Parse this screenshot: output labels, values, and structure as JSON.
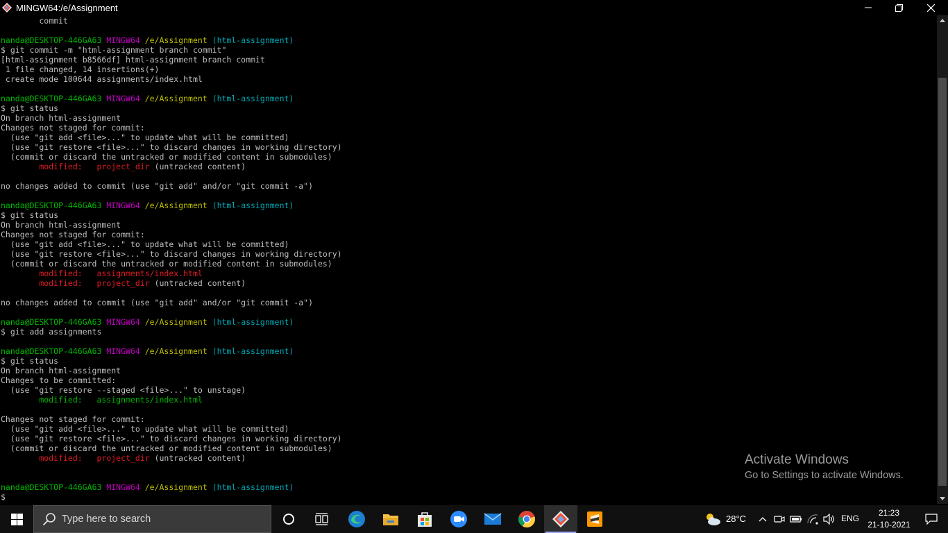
{
  "window": {
    "title": "MINGW64:/e/Assignment",
    "minimize_label": "—",
    "restore_label": "❐",
    "close_label": "✕"
  },
  "terminal": {
    "lines": [
      [
        {
          "t": "        commit",
          "c": "default"
        }
      ],
      [],
      [
        {
          "t": "nanda@DESKTOP-446GA63 ",
          "c": "green"
        },
        {
          "t": "MINGW64 ",
          "c": "magenta"
        },
        {
          "t": "/e/Assignment ",
          "c": "yellow"
        },
        {
          "t": "(html-assignment)",
          "c": "cyan"
        }
      ],
      [
        {
          "t": "$ git commit -m \"html-assignment branch commit\"",
          "c": "default"
        }
      ],
      [
        {
          "t": "[html-assignment b8566df] html-assignment branch commit",
          "c": "default"
        }
      ],
      [
        {
          "t": " 1 file changed, 14 insertions(+)",
          "c": "default"
        }
      ],
      [
        {
          "t": " create mode 100644 assignments/index.html",
          "c": "default"
        }
      ],
      [],
      [
        {
          "t": "nanda@DESKTOP-446GA63 ",
          "c": "green"
        },
        {
          "t": "MINGW64 ",
          "c": "magenta"
        },
        {
          "t": "/e/Assignment ",
          "c": "yellow"
        },
        {
          "t": "(html-assignment)",
          "c": "cyan"
        }
      ],
      [
        {
          "t": "$ git status",
          "c": "default"
        }
      ],
      [
        {
          "t": "On branch html-assignment",
          "c": "default"
        }
      ],
      [
        {
          "t": "Changes not staged for commit:",
          "c": "default"
        }
      ],
      [
        {
          "t": "  (use \"git add <file>...\" to update what will be committed)",
          "c": "default"
        }
      ],
      [
        {
          "t": "  (use \"git restore <file>...\" to discard changes in working directory)",
          "c": "default"
        }
      ],
      [
        {
          "t": "  (commit or discard the untracked or modified content in submodules)",
          "c": "default"
        }
      ],
      [
        {
          "t": "        modified:   project_dir",
          "c": "red"
        },
        {
          "t": " (untracked content)",
          "c": "default"
        }
      ],
      [],
      [
        {
          "t": "no changes added to commit (use \"git add\" and/or \"git commit -a\")",
          "c": "default"
        }
      ],
      [],
      [
        {
          "t": "nanda@DESKTOP-446GA63 ",
          "c": "green"
        },
        {
          "t": "MINGW64 ",
          "c": "magenta"
        },
        {
          "t": "/e/Assignment ",
          "c": "yellow"
        },
        {
          "t": "(html-assignment)",
          "c": "cyan"
        }
      ],
      [
        {
          "t": "$ git status",
          "c": "default"
        }
      ],
      [
        {
          "t": "On branch html-assignment",
          "c": "default"
        }
      ],
      [
        {
          "t": "Changes not staged for commit:",
          "c": "default"
        }
      ],
      [
        {
          "t": "  (use \"git add <file>...\" to update what will be committed)",
          "c": "default"
        }
      ],
      [
        {
          "t": "  (use \"git restore <file>...\" to discard changes in working directory)",
          "c": "default"
        }
      ],
      [
        {
          "t": "  (commit or discard the untracked or modified content in submodules)",
          "c": "default"
        }
      ],
      [
        {
          "t": "        modified:   assignments/index.html",
          "c": "red"
        }
      ],
      [
        {
          "t": "        modified:   project_dir",
          "c": "red"
        },
        {
          "t": " (untracked content)",
          "c": "default"
        }
      ],
      [],
      [
        {
          "t": "no changes added to commit (use \"git add\" and/or \"git commit -a\")",
          "c": "default"
        }
      ],
      [],
      [
        {
          "t": "nanda@DESKTOP-446GA63 ",
          "c": "green"
        },
        {
          "t": "MINGW64 ",
          "c": "magenta"
        },
        {
          "t": "/e/Assignment ",
          "c": "yellow"
        },
        {
          "t": "(html-assignment)",
          "c": "cyan"
        }
      ],
      [
        {
          "t": "$ git add assignments",
          "c": "default"
        }
      ],
      [],
      [
        {
          "t": "nanda@DESKTOP-446GA63 ",
          "c": "green"
        },
        {
          "t": "MINGW64 ",
          "c": "magenta"
        },
        {
          "t": "/e/Assignment ",
          "c": "yellow"
        },
        {
          "t": "(html-assignment)",
          "c": "cyan"
        }
      ],
      [
        {
          "t": "$ git status",
          "c": "default"
        }
      ],
      [
        {
          "t": "On branch html-assignment",
          "c": "default"
        }
      ],
      [
        {
          "t": "Changes to be committed:",
          "c": "default"
        }
      ],
      [
        {
          "t": "  (use \"git restore --staged <file>...\" to unstage)",
          "c": "default"
        }
      ],
      [
        {
          "t": "        modified:   assignments/index.html",
          "c": "green"
        }
      ],
      [],
      [
        {
          "t": "Changes not staged for commit:",
          "c": "default"
        }
      ],
      [
        {
          "t": "  (use \"git add <file>...\" to update what will be committed)",
          "c": "default"
        }
      ],
      [
        {
          "t": "  (use \"git restore <file>...\" to discard changes in working directory)",
          "c": "default"
        }
      ],
      [
        {
          "t": "  (commit or discard the untracked or modified content in submodules)",
          "c": "default"
        }
      ],
      [
        {
          "t": "        modified:   project_dir",
          "c": "red"
        },
        {
          "t": " (untracked content)",
          "c": "default"
        }
      ],
      [],
      [],
      [
        {
          "t": "nanda@DESKTOP-446GA63 ",
          "c": "green"
        },
        {
          "t": "MINGW64 ",
          "c": "magenta"
        },
        {
          "t": "/e/Assignment ",
          "c": "yellow"
        },
        {
          "t": "(html-assignment)",
          "c": "cyan"
        }
      ],
      [
        {
          "t": "$",
          "c": "default"
        }
      ]
    ]
  },
  "colors": {
    "green": "#00b800",
    "magenta": "#bf00bf",
    "yellow": "#bfbf00",
    "cyan": "#00a6b2",
    "red": "#e01b24",
    "default": "#bfbfbf"
  },
  "watermark": {
    "title": "Activate Windows",
    "subtitle": "Go to Settings to activate Windows."
  },
  "taskbar": {
    "search_placeholder": "Type here to search",
    "apps": [
      "cortana-icon",
      "task-view-icon",
      "edge-icon",
      "file-explorer-icon",
      "microsoft-store-icon",
      "zoom-icon",
      "mail-icon",
      "chrome-icon",
      "git-bash-icon",
      "sublime-text-icon"
    ],
    "weather_temp": "28°C",
    "language": "ENG",
    "time": "21:23",
    "date": "21-10-2021"
  }
}
